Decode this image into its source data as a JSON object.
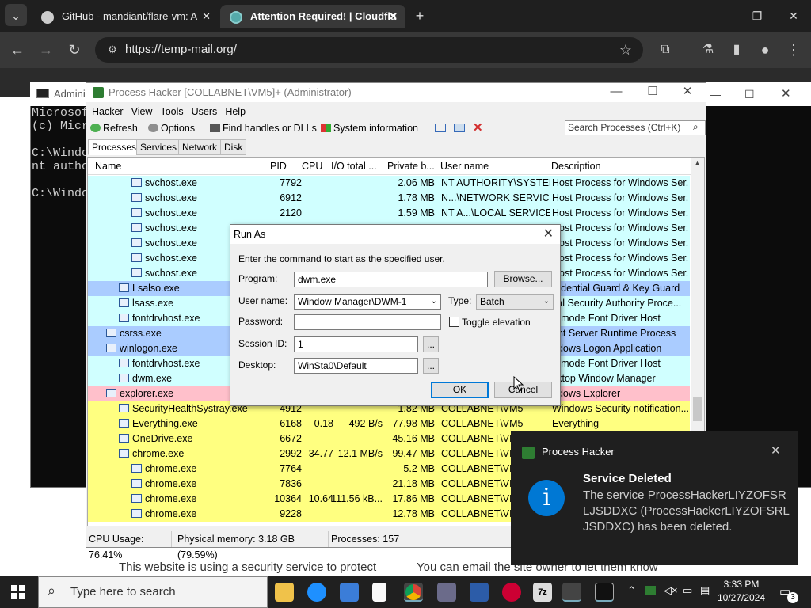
{
  "browser": {
    "tabs": [
      {
        "title": "GitHub - mandiant/flare-vm: A"
      },
      {
        "title": "Attention Required! | Cloudfla"
      }
    ],
    "url": "https://temp-mail.org/",
    "new_tab": "+"
  },
  "cmd": {
    "title": "Admini",
    "lines": [
      "Microsoft",
      "(c) Micro",
      "",
      "C:\\Window",
      "nt author",
      "",
      "C:\\Window"
    ]
  },
  "process_hacker": {
    "title": "Process Hacker [COLLABNET\\VM5]+ (Administrator)",
    "menu": [
      "Hacker",
      "View",
      "Tools",
      "Users",
      "Help"
    ],
    "toolbar": {
      "refresh": "Refresh",
      "options": "Options",
      "find_handles": "Find handles or DLLs",
      "system_info": "System information"
    },
    "search_placeholder": "Search Processes (Ctrl+K)",
    "tabs": [
      "Processes",
      "Services",
      "Network",
      "Disk"
    ],
    "columns": [
      "Name",
      "PID",
      "CPU",
      "I/O total ...",
      "Private b...",
      "User name",
      "Description"
    ],
    "rows": [
      {
        "name": "svchost.exe",
        "pid": "7792",
        "cpu": "",
        "io": "",
        "priv": "2.06 MB",
        "user": "NT AUTHORITY\\SYSTEM",
        "desc": "Host Process for Windows Ser..."
      },
      {
        "name": "svchost.exe",
        "pid": "6912",
        "cpu": "",
        "io": "",
        "priv": "1.78 MB",
        "user": "N...\\NETWORK SERVICE",
        "desc": "Host Process for Windows Ser..."
      },
      {
        "name": "svchost.exe",
        "pid": "2120",
        "cpu": "",
        "io": "",
        "priv": "1.59 MB",
        "user": "NT A...\\LOCAL SERVICE",
        "desc": "Host Process for Windows Ser..."
      },
      {
        "name": "svchost.exe",
        "pid": "",
        "cpu": "",
        "io": "",
        "priv": "",
        "user": "",
        "desc": "Host Process for Windows Ser..."
      },
      {
        "name": "svchost.exe",
        "pid": "",
        "cpu": "",
        "io": "",
        "priv": "",
        "user": "",
        "desc": "Host Process for Windows Ser..."
      },
      {
        "name": "svchost.exe",
        "pid": "",
        "cpu": "",
        "io": "",
        "priv": "",
        "user": "",
        "desc": "Host Process for Windows Ser..."
      },
      {
        "name": "svchost.exe",
        "pid": "",
        "cpu": "",
        "io": "",
        "priv": "",
        "user": "",
        "desc": "Host Process for Windows Ser..."
      },
      {
        "name": "Lsalso.exe",
        "pid": "",
        "cpu": "",
        "io": "",
        "priv": "",
        "user": "",
        "desc": "redential Guard & Key Guard"
      },
      {
        "name": "lsass.exe",
        "pid": "",
        "cpu": "",
        "io": "",
        "priv": "",
        "user": "",
        "desc": "cal Security Authority Proce..."
      },
      {
        "name": "fontdrvhost.exe",
        "pid": "",
        "cpu": "",
        "io": "",
        "priv": "",
        "user": "",
        "desc": "ermode Font Driver Host"
      },
      {
        "name": "csrss.exe",
        "pid": "",
        "cpu": "",
        "io": "",
        "priv": "",
        "user": "",
        "desc": "ent Server Runtime Process"
      },
      {
        "name": "winlogon.exe",
        "pid": "",
        "cpu": "",
        "io": "",
        "priv": "",
        "user": "",
        "desc": "ndows Logon Application"
      },
      {
        "name": "fontdrvhost.exe",
        "pid": "",
        "cpu": "",
        "io": "",
        "priv": "",
        "user": "",
        "desc": "ermode Font Driver Host"
      },
      {
        "name": "dwm.exe",
        "pid": "",
        "cpu": "",
        "io": "",
        "priv": "",
        "user": "",
        "desc": "sktop Window Manager"
      },
      {
        "name": "explorer.exe",
        "pid": "",
        "cpu": "",
        "io": "",
        "priv": "",
        "user": "",
        "desc": "ndows Explorer"
      },
      {
        "name": "SecurityHealthSystray.exe",
        "pid": "4912",
        "cpu": "",
        "io": "",
        "priv": "1.82 MB",
        "user": "COLLABNET\\VM5",
        "desc": "Windows Security notification..."
      },
      {
        "name": "Everything.exe",
        "pid": "6168",
        "cpu": "0.18",
        "io": "492 B/s",
        "priv": "77.98 MB",
        "user": "COLLABNET\\VM5",
        "desc": "Everything"
      },
      {
        "name": "OneDrive.exe",
        "pid": "6672",
        "cpu": "",
        "io": "",
        "priv": "45.16 MB",
        "user": "COLLABNET\\VM5",
        "desc": ""
      },
      {
        "name": "chrome.exe",
        "pid": "2992",
        "cpu": "34.77",
        "io": "12.1 MB/s",
        "priv": "99.47 MB",
        "user": "COLLABNET\\VM",
        "desc": ""
      },
      {
        "name": "chrome.exe",
        "pid": "7764",
        "cpu": "",
        "io": "",
        "priv": "5.2 MB",
        "user": "COLLABNET\\VM",
        "desc": ""
      },
      {
        "name": "chrome.exe",
        "pid": "7836",
        "cpu": "",
        "io": "",
        "priv": "21.18 MB",
        "user": "COLLABNET\\VM",
        "desc": ""
      },
      {
        "name": "chrome.exe",
        "pid": "10364",
        "cpu": "10.64",
        "io": "111.56 kB...",
        "priv": "17.86 MB",
        "user": "COLLABNET\\VM",
        "desc": ""
      },
      {
        "name": "chrome.exe",
        "pid": "9228",
        "cpu": "",
        "io": "",
        "priv": "12.78 MB",
        "user": "COLLABNET\\VM",
        "desc": ""
      }
    ],
    "status": {
      "cpu": "CPU Usage: 76.41%",
      "mem": "Physical memory: 3.18 GB (79.59%)",
      "procs": "Processes: 157"
    }
  },
  "run_as": {
    "title": "Run As",
    "instruction": "Enter the command to start as the specified user.",
    "program_label": "Program:",
    "program_value": "dwm.exe",
    "browse": "Browse...",
    "user_label": "User name:",
    "user_value": "Window Manager\\DWM-1",
    "type_label": "Type:",
    "type_value": "Batch",
    "password_label": "Password:",
    "password_value": "",
    "toggle_elevation": "Toggle elevation",
    "session_label": "Session ID:",
    "session_value": "1",
    "desktop_label": "Desktop:",
    "desktop_value": "WinSta0\\Default",
    "ellipsis": "...",
    "ok": "OK",
    "cancel": "Cancel"
  },
  "page_text": {
    "left": "This website is using a security service to protect",
    "right": "You can email the site owner to let them know"
  },
  "notification": {
    "app": "Process Hacker",
    "title": "Service Deleted",
    "body": "The service ProcessHackerLIYZOFSRLJSDDXC (ProcessHackerLIYZOFSRLJSDDXC) has been deleted."
  },
  "taskbar": {
    "search_placeholder": "Type here to search",
    "time": "3:33 PM",
    "date": "10/27/2024",
    "notif_count": "3"
  },
  "colors": {
    "service": "#d0ffff",
    "system": "#aaccff",
    "user": "#ffff80",
    "explorer": "#ffc0cb",
    "accent": "#0078d4"
  }
}
